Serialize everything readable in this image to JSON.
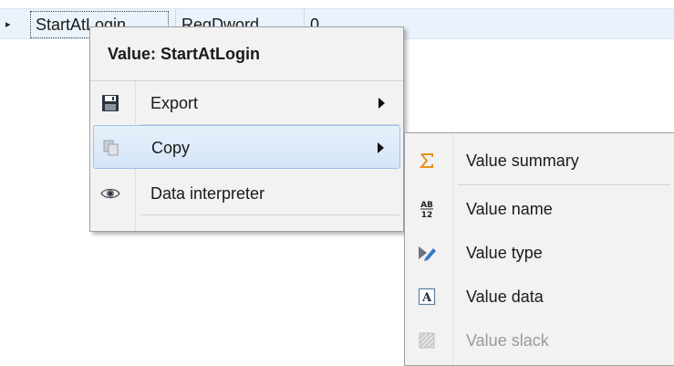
{
  "grid": {
    "expander_glyph": "▸",
    "row": {
      "name": "StartAtLogin",
      "type": "RegDword",
      "data": "0"
    }
  },
  "context_menu": {
    "header": "Value: StartAtLogin",
    "items": [
      {
        "label": "Export",
        "icon": "floppy-disk-icon",
        "has_submenu": true
      },
      {
        "label": "Copy",
        "icon": "copy-icon",
        "has_submenu": true,
        "active": true
      },
      {
        "label": "Data interpreter",
        "icon": "eye-icon",
        "has_submenu": false
      }
    ]
  },
  "copy_submenu": {
    "items": [
      {
        "label": "Value summary",
        "icon": "sigma-icon",
        "enabled": true
      },
      {
        "label": "Value name",
        "icon": "ab-12-icon",
        "enabled": true
      },
      {
        "label": "Value type",
        "icon": "type-pencil-icon",
        "enabled": true
      },
      {
        "label": "Value data",
        "icon": "letter-a-icon",
        "enabled": true
      },
      {
        "label": "Value slack",
        "icon": "hatched-square-icon",
        "enabled": false
      }
    ]
  },
  "colors": {
    "row_highlight": "#eaf2fb",
    "menu_background": "#f2f2f2",
    "active_item_border": "#9cc2e8",
    "sigma_orange": "#e8901a",
    "pencil_blue": "#3a78c6",
    "disabled_text": "#9a9a9a"
  }
}
